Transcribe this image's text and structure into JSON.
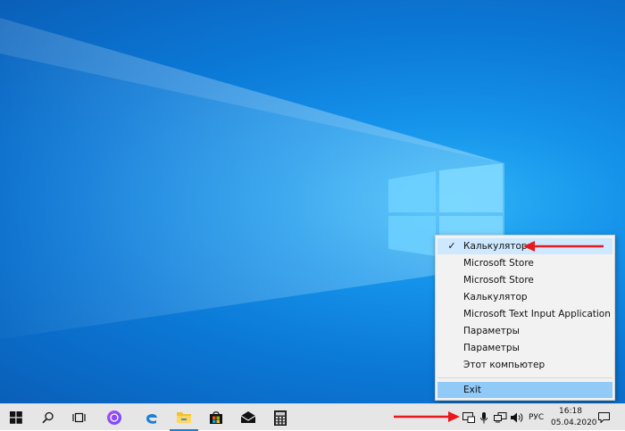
{
  "context_menu": {
    "items": [
      {
        "label": "Калькулятор",
        "checked": true
      },
      {
        "label": "Microsoft Store"
      },
      {
        "label": "Microsoft Store"
      },
      {
        "label": "Калькулятор"
      },
      {
        "label": "Microsoft Text Input Application"
      },
      {
        "label": "Параметры"
      },
      {
        "label": "Параметры"
      },
      {
        "label": "Этот компьютер"
      }
    ],
    "exit_label": "Exit"
  },
  "taskbar": {
    "apps": [
      "windows-start-icon",
      "search-icon",
      "task-view-icon",
      "alice-assistant-icon",
      "edge-icon",
      "file-explorer-icon",
      "store-icon",
      "mail-icon",
      "calculator-icon"
    ],
    "tray": {
      "language": "РУС",
      "time": "16:18",
      "date": "05.04.2020"
    }
  },
  "colors": {
    "desktop": "#0b78d6",
    "menu_bg": "#f2f2f2",
    "menu_selected": "#cde8ff",
    "menu_hover": "#91c9f7",
    "taskbar": "#e6e6e6",
    "arrow": "#e8191c"
  }
}
